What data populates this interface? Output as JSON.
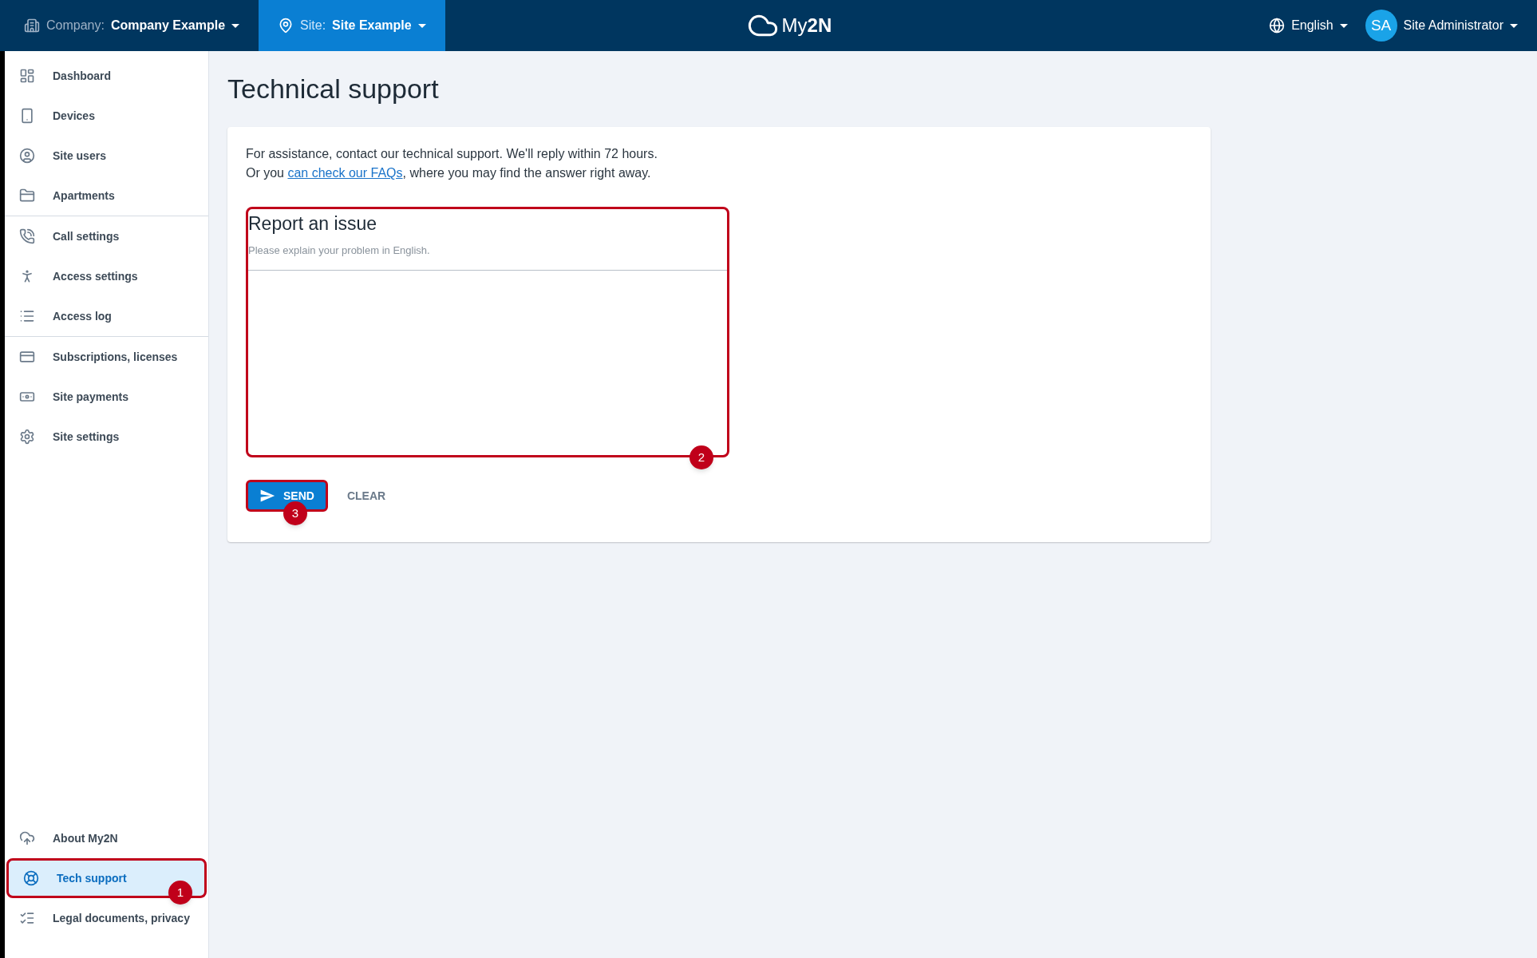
{
  "topbar": {
    "company": {
      "label": "Company:",
      "value": "Company Example",
      "selected": false
    },
    "site": {
      "label": "Site:",
      "value": "Site Example",
      "selected": true
    },
    "logo": "My**2N**",
    "language": "English",
    "user": {
      "initials": "SA",
      "name": "Site Administrator"
    }
  },
  "sidebar": {
    "groups": [
      {
        "items": [
          {
            "label": "Dashboard",
            "selected": false
          },
          {
            "label": "Devices",
            "selected": false
          },
          {
            "label": "Site users",
            "selected": false
          },
          {
            "label": "Apartments",
            "selected": false
          }
        ]
      },
      {
        "items": [
          {
            "label": "Call settings",
            "selected": false
          },
          {
            "label": "Access settings",
            "selected": false
          },
          {
            "label": "Access log",
            "selected": false
          }
        ]
      },
      {
        "items": [
          {
            "label": "Subscriptions, licenses",
            "selected": false
          },
          {
            "label": "Site payments",
            "selected": false
          },
          {
            "label": "Site settings",
            "selected": false
          }
        ]
      }
    ],
    "bottom": [
      {
        "label": "About My2N",
        "selected": false
      },
      {
        "label": "Tech support",
        "selected": true,
        "callout": "1"
      },
      {
        "label": "Legal documents, privacy",
        "selected": false
      }
    ]
  },
  "page": {
    "title": "Technical support",
    "intro": [
      "For assistance, contact our technical support. We'll reply within 72 hours."
    ],
    "intro2": {
      "before": "Or you ",
      "link": "can check our FAQs",
      "after": ", where you may find the answer right away."
    },
    "form": {
      "title": "Report an issue",
      "hint": "Please explain your problem in English.",
      "callout": "2"
    },
    "send": {
      "label": "SEND",
      "callout": "3"
    },
    "clear": {
      "label": "CLEAR"
    }
  }
}
